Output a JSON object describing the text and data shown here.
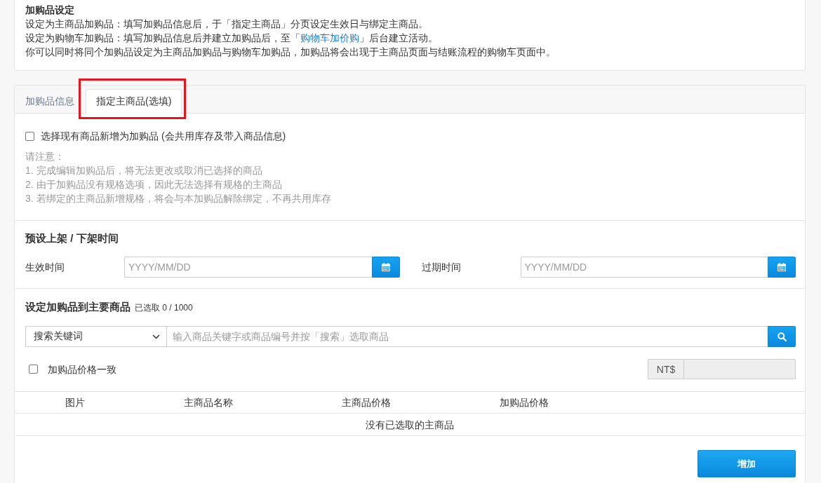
{
  "intro": {
    "title": "加购品设定",
    "lines": [
      {
        "text": "设定为主商品加购品：填写加购品信息后，于「指定主商品」分页设定生效日与绑定主商品。"
      },
      {
        "text": "设定为购物车加购品：填写加购品信息后并建立加购品后，至「",
        "link": "购物车加价购",
        "after": "」后台建立活动。"
      },
      {
        "text": "你可以同时将同个加购品设定为主商品加购品与购物车加购品，加购品将会出现于主商品页面与结账流程的购物车页面中。"
      }
    ]
  },
  "tabs": [
    {
      "label": "加购品信息",
      "selected": false,
      "highlighted": false
    },
    {
      "label": "指定主商品(选填)",
      "selected": true,
      "highlighted": true
    }
  ],
  "existing_product": {
    "label": "选择现有商品新增为加购品 (会共用库存及带入商品信息)",
    "checked": false
  },
  "notes": {
    "title": "请注意：",
    "items": [
      "1. 完成编辑加购品后，将无法更改或取消已选择的商品",
      "2. 由于加购品没有规格选项，因此无法选择有规格的主商品",
      "3. 若绑定的主商品新增规格，将会与本加购品解除绑定，不再共用库存"
    ]
  },
  "schedule": {
    "title": "预设上架 / 下架时间",
    "fields": [
      {
        "label": "生效时间",
        "placeholder": "YYYY/MM/DD"
      },
      {
        "label": "过期时间",
        "placeholder": "YYYY/MM/DD"
      }
    ]
  },
  "main_products": {
    "title": "设定加购品到主要商品",
    "count": "已选取 0 / 1000",
    "search_type": "搜索关键词",
    "search": {
      "placeholder": "输入商品关键字或商品编号并按「搜索」选取商品"
    },
    "same_price": {
      "label": "加购品价格一致",
      "checked": false
    },
    "price": {
      "prefix": "NT$",
      "disabled": true
    },
    "table": {
      "columns": [
        "图片",
        "主商品名称",
        "主商品价格",
        "加购品价格"
      ],
      "empty_text": "没有已选取的主商品"
    },
    "add_button": "增加"
  }
}
